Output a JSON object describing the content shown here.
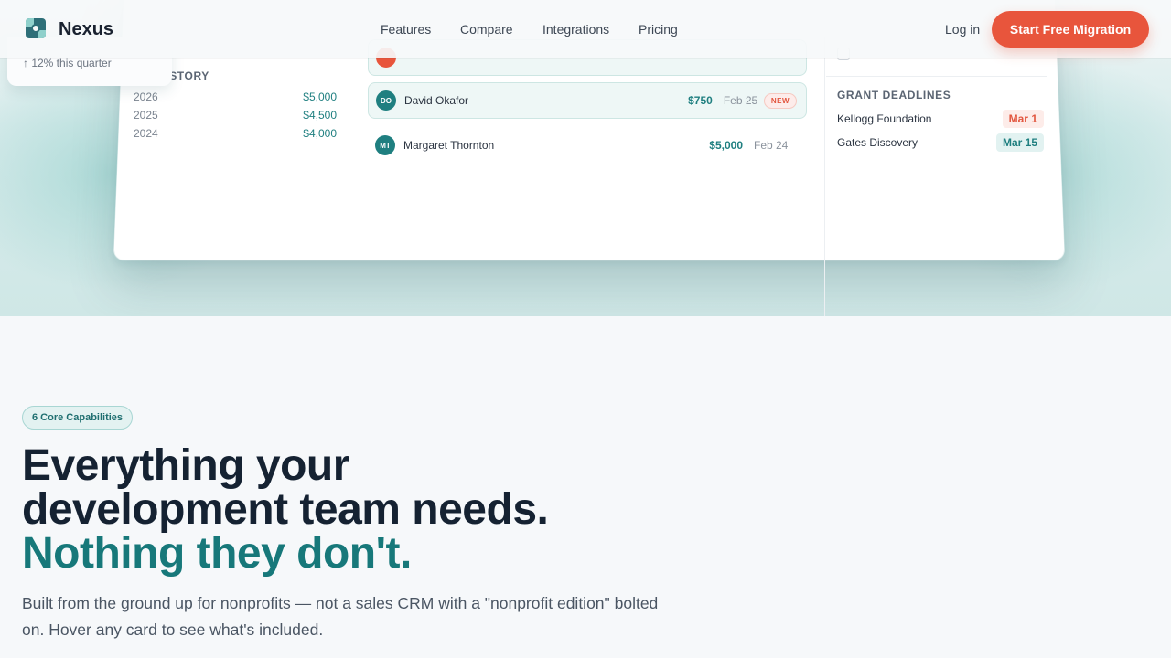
{
  "nav": {
    "brand": "Nexus",
    "links": [
      "Features",
      "Compare",
      "Integrations",
      "Pricing"
    ],
    "login": "Log in",
    "cta": "Start Free Migration"
  },
  "dashboard": {
    "stat_note": "↑ 12% this quarter",
    "giving_history": {
      "title": "HISTORY",
      "rows": [
        {
          "year": "2026",
          "amount": "$5,000"
        },
        {
          "year": "2025",
          "amount": "$4,500"
        },
        {
          "year": "2024",
          "amount": "$4,000"
        }
      ]
    },
    "donors": [
      {
        "initials": "DO",
        "name": "David Okafor",
        "amount": "$750",
        "date": "Feb 25",
        "badge": "NEW",
        "color": "#1f7f80"
      },
      {
        "initials": "MT",
        "name": "Margaret Thornton",
        "amount": "$5,000",
        "date": "Feb 24",
        "badge": "",
        "color": "#1f7f80"
      }
    ],
    "grants": {
      "title": "GRANT DEADLINES",
      "rows": [
        {
          "name": "Kellogg Foundation",
          "date": "Mar 1"
        },
        {
          "name": "Gates Discovery",
          "date": "Mar 15"
        }
      ]
    }
  },
  "features": {
    "pill": "6 Core Capabilities",
    "headline_line1": "Everything your",
    "headline_line2": "development team needs.",
    "headline_accent": "Nothing they don't.",
    "subtext": "Built from the ground up for nonprofits — not a sales CRM with a \"nonprofit edition\" bolted on. Hover any card to see what's included."
  },
  "colors": {
    "accent_teal": "#17787a",
    "cta_orange": "#e8553c",
    "badge_red": "#e2563f"
  }
}
